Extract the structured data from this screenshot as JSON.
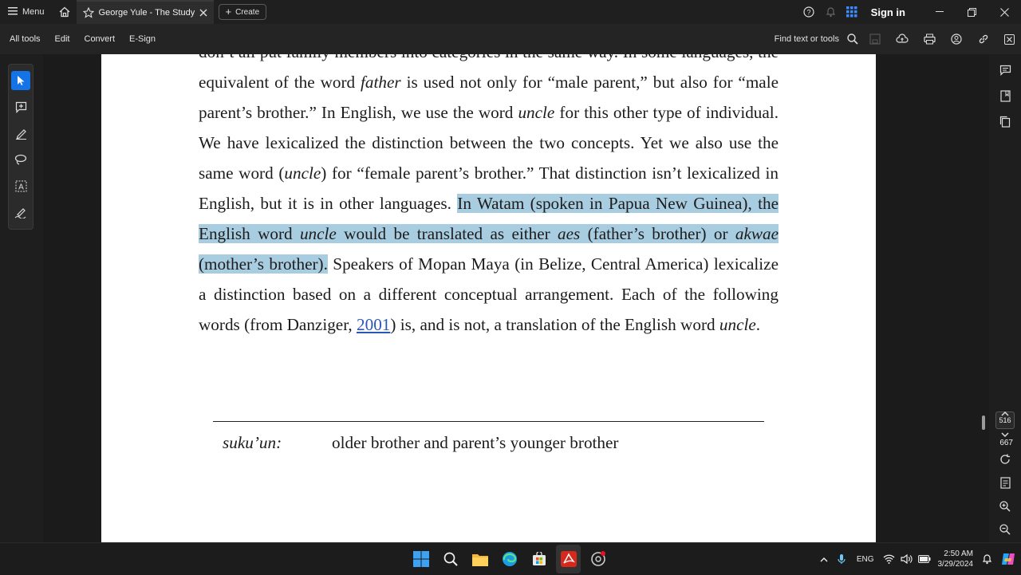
{
  "titlebar": {
    "menu_label": "Menu",
    "tab_title": "George Yule - The Study ...",
    "create_label": "Create",
    "signin_label": "Sign in"
  },
  "toolbar": {
    "items": [
      "All tools",
      "Edit",
      "Convert",
      "E-Sign"
    ],
    "find_label": "Find text or tools"
  },
  "document": {
    "p1": "don’t all put family members into categories in the same way. In some languages, the equivalent of the word ",
    "w_father": "father",
    "p2": " is used not only for “male parent,” but also for “male parent’s brother.” In English, we use the word ",
    "w_uncle1": "uncle",
    "p3": " for this other type of individual. We have lexicalized the distinction between the two concepts. Yet we also use the same word (",
    "w_uncle2": "uncle",
    "p4": ") for “female parent’s brother.” That distinction isn’t lexicalized in English, but it is in other languages. ",
    "s1": "In Watam (spoken in Papua New Guinea), the English word ",
    "w_uncle3": "uncle",
    "s2": " would be translated as either ",
    "w_aes": "aes",
    "s3": " (father’s brother) or ",
    "w_akwae": "akwae",
    "s4": " (mother’s brother).",
    "p5": " Speakers of Mopan Maya (in Belize, Central America) lexicalize a distinction based on a different conceptual arrangement. Each of the following words (from Danziger, ",
    "cite": "2001",
    "p6": ") is, and is not, a translation of the English word ",
    "w_uncle4": "uncle",
    "p7": ".",
    "gloss_term": "suku’un:",
    "gloss_def": "older brother and parent’s younger brother"
  },
  "page_nav": {
    "current": "516",
    "total": "667"
  },
  "taskbar": {
    "lang": "ENG",
    "time": "2:50 AM",
    "date": "3/29/2024"
  }
}
